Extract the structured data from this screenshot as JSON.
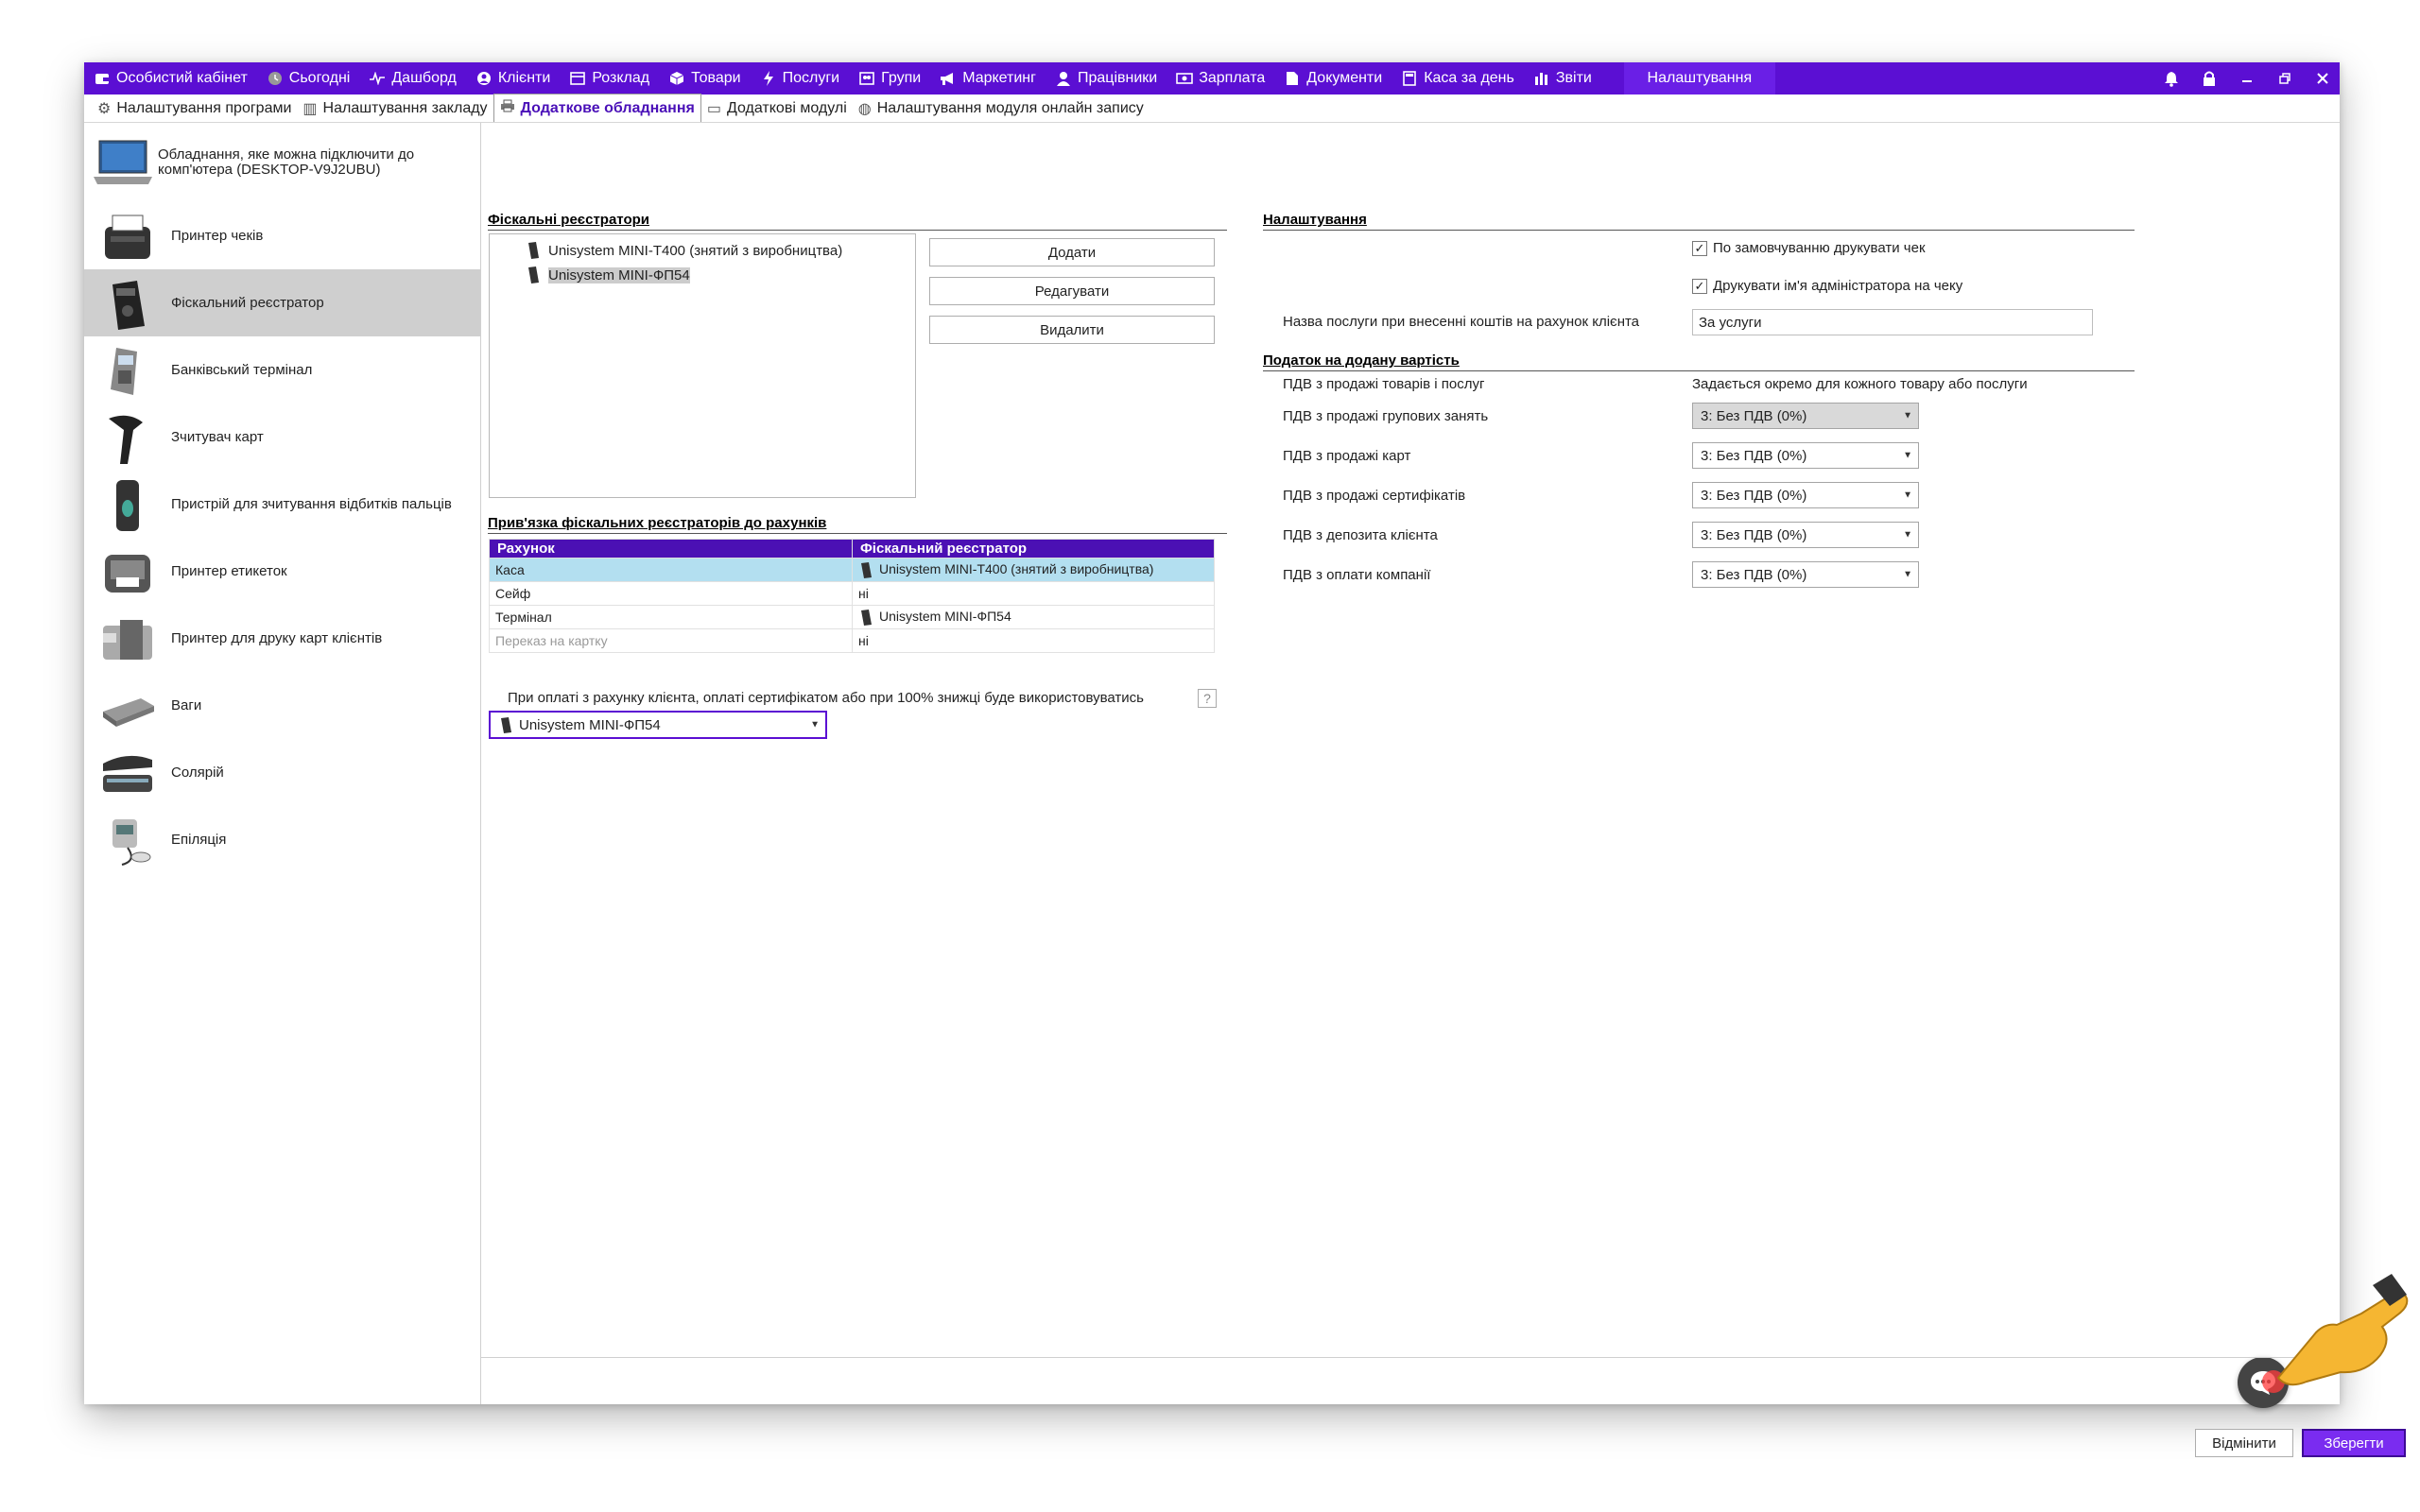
{
  "topnav": {
    "items": [
      {
        "label": "Особистий кабінет",
        "icon": "wallet-icon"
      },
      {
        "label": "Сьогодні",
        "icon": "clock-icon"
      },
      {
        "label": "Дашборд",
        "icon": "pulse-icon"
      },
      {
        "label": "Клієнти",
        "icon": "user-circle-icon"
      },
      {
        "label": "Розклад",
        "icon": "calendar-icon"
      },
      {
        "label": "Товари",
        "icon": "box-icon"
      },
      {
        "label": "Послуги",
        "icon": "lightning-icon"
      },
      {
        "label": "Групи",
        "icon": "groups-icon"
      },
      {
        "label": "Маркетинг",
        "icon": "megaphone-icon"
      },
      {
        "label": "Працівники",
        "icon": "person-icon"
      },
      {
        "label": "Зарплата",
        "icon": "cash-icon"
      },
      {
        "label": "Документи",
        "icon": "document-icon"
      },
      {
        "label": "Каса за день",
        "icon": "calculator-icon"
      },
      {
        "label": "Звіти",
        "icon": "bar-chart-icon"
      }
    ],
    "active": "Налаштування"
  },
  "subtabs": [
    {
      "label": "Налаштування програми",
      "icon": "gear-icon"
    },
    {
      "label": "Налаштування закладу",
      "icon": "building-icon"
    },
    {
      "label": "Додаткове обладнання",
      "icon": "printer-icon"
    },
    {
      "label": "Додаткові модулі",
      "icon": "module-icon"
    },
    {
      "label": "Налаштування модуля онлайн запису",
      "icon": "globe-icon"
    }
  ],
  "sidebar": {
    "header": "Обладнання, яке можна підключити до комп'ютера (DESKTOP-V9J2UBU)",
    "items": [
      {
        "label": "Принтер чеків",
        "icon": "receipt-printer-icon"
      },
      {
        "label": "Фіскальний реєстратор",
        "icon": "fiscal-register-icon"
      },
      {
        "label": "Банківський термінал",
        "icon": "bank-terminal-icon"
      },
      {
        "label": "Зчитувач карт",
        "icon": "card-reader-icon"
      },
      {
        "label": "Пристрій для зчитування відбитків пальців",
        "icon": "fingerprint-reader-icon"
      },
      {
        "label": "Принтер етикеток",
        "icon": "label-printer-icon"
      },
      {
        "label": "Принтер для друку карт клієнтів",
        "icon": "card-printer-icon"
      },
      {
        "label": "Ваги",
        "icon": "scales-icon"
      },
      {
        "label": "Солярій",
        "icon": "solarium-icon"
      },
      {
        "label": "Епіляція",
        "icon": "epilation-icon"
      }
    ],
    "selected": "Фіскальний реєстратор"
  },
  "fiscal": {
    "title": "Фіскальні реєстратори",
    "registers": [
      "Unisystem MINI-T400 (знятий з виробництва)",
      "Unisystem MINI-ФП54"
    ],
    "buttons": {
      "add": "Додати",
      "edit": "Редагувати",
      "delete": "Видалити"
    }
  },
  "binding": {
    "title": "Прив'язка фіскальних реєстраторів до рахунків",
    "columns": [
      "Рахунок",
      "Фіскальний реєстратор"
    ],
    "rows": [
      {
        "account": "Каса",
        "register": "Unisystem MINI-T400 (знятий з виробництва)"
      },
      {
        "account": "Сейф",
        "register": "ні"
      },
      {
        "account": "Термінал",
        "register": "Unisystem MINI-ФП54"
      },
      {
        "account": "Переказ на картку",
        "register": "ні"
      }
    ]
  },
  "payment": {
    "label": "При оплаті з рахунку клієнта, оплаті сертифікатом або при 100% знижці буде використовуватись",
    "help": "?",
    "selected": "Unisystem MINI-ФП54"
  },
  "settings": {
    "title": "Налаштування",
    "print_receipt": "По замовчуванню друкувати чек",
    "print_admin": "Друкувати ім'я адміністратора на чеку",
    "service_label": "Назва послуги при внесенні коштів на рахунок клієнта",
    "service_value": "За услуги"
  },
  "vat": {
    "title": "Податок на додану вартість",
    "goods_label": "ПДВ з продажі товарів і послуг",
    "goods_value": "Задається окремо для кожного товару або послуги",
    "rows": [
      {
        "label": "ПДВ з продажі групових занять",
        "value": "3: Без ПДВ (0%)"
      },
      {
        "label": "ПДВ з продажі карт",
        "value": "3: Без ПДВ (0%)"
      },
      {
        "label": "ПДВ з продажі сертифікатів",
        "value": "3: Без ПДВ (0%)"
      },
      {
        "label": "ПДВ з депозита клієнта",
        "value": "3: Без ПДВ (0%)"
      },
      {
        "label": "ПДВ з оплати компанії",
        "value": "3: Без ПДВ (0%)"
      }
    ]
  },
  "footer": {
    "cancel": "Відмінити",
    "save": "Зберегти"
  },
  "colors": {
    "accent": "#5b0fd3",
    "table_header": "#4b10b4",
    "selected_row": "#b3dff0"
  }
}
